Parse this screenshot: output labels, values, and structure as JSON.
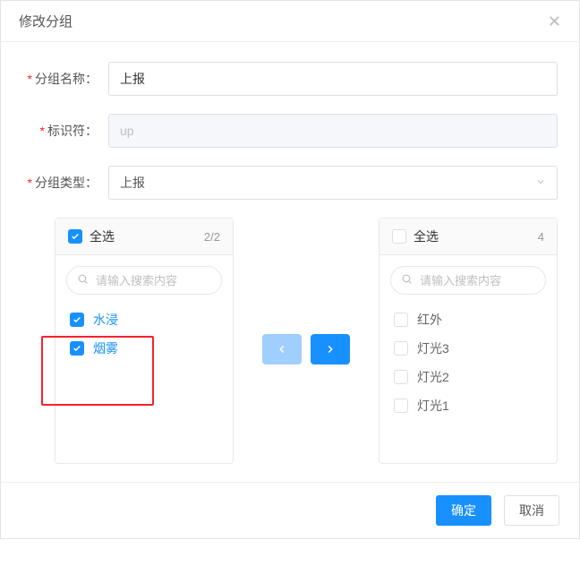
{
  "modal": {
    "title": "修改分组",
    "close_icon_name": "close-icon"
  },
  "form": {
    "group_name": {
      "label": "分组名称：",
      "value": "上报"
    },
    "identifier": {
      "label": "标识符：",
      "value": "up"
    },
    "group_type": {
      "label": "分组类型：",
      "value": "上报"
    }
  },
  "transfer": {
    "left": {
      "select_all_label": "全选",
      "select_all_checked": true,
      "count_text": "2/2",
      "search_placeholder": "请输入搜索内容",
      "items": [
        {
          "label": "水浸",
          "checked": true
        },
        {
          "label": "烟雾",
          "checked": true
        }
      ]
    },
    "right": {
      "select_all_label": "全选",
      "select_all_checked": false,
      "count_text": "4",
      "search_placeholder": "请输入搜索内容",
      "items": [
        {
          "label": "红外",
          "checked": false
        },
        {
          "label": "灯光3",
          "checked": false
        },
        {
          "label": "灯光2",
          "checked": false
        },
        {
          "label": "灯光1",
          "checked": false
        }
      ]
    }
  },
  "footer": {
    "ok_label": "确定",
    "cancel_label": "取消"
  }
}
